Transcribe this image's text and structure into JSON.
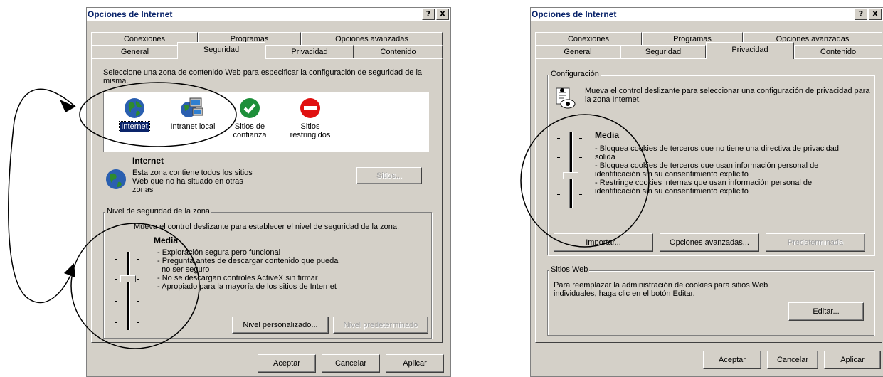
{
  "left_dialog": {
    "title": "Opciones de Internet",
    "title_buttons": [
      "?",
      "X"
    ],
    "tabs_row1": [
      "Conexiones",
      "Programas",
      "Opciones avanzadas"
    ],
    "tabs_row2": [
      "General",
      "Seguridad",
      "Privacidad",
      "Contenido"
    ],
    "active_tab": "Seguridad",
    "instructions": "Seleccione una zona de contenido Web para especificar la configuración de seguridad de la misma.",
    "zones": [
      {
        "label": "Internet",
        "icon": "globe-icon",
        "selected": true
      },
      {
        "label": "Intranet local",
        "icon": "network-computer-icon",
        "selected": false
      },
      {
        "label": "Sitios de confianza",
        "icon": "check-icon",
        "selected": false
      },
      {
        "label": "Sitios restringidos",
        "icon": "no-entry-icon",
        "selected": false
      }
    ],
    "zone_title": "Internet",
    "zone_desc": "Esta zona contiene todos los sitios Web que no ha situado en otras zonas",
    "sites_button": "Sitios...",
    "security_group_title": "Nivel de seguridad de la zona",
    "slider_instruction": "Mueva el control deslizante para establecer el nivel de seguridad de la zona.",
    "level_name": "Media",
    "level_bullets": [
      "- Exploración segura pero funcional",
      "- Pregunta antes de descargar contenido que pueda",
      "  no ser seguro",
      "- No se descargan controles ActiveX sin firmar",
      "- Apropiado para la mayoría de los sitios de Internet"
    ],
    "custom_level_button": "Nivel personalizado...",
    "default_level_button": "Nivel predeterminado",
    "ok_button": "Aceptar",
    "cancel_button": "Cancelar",
    "apply_button": "Aplicar"
  },
  "right_dialog": {
    "title": "Opciones de Internet",
    "title_buttons": [
      "?",
      "X"
    ],
    "tabs_row1": [
      "Conexiones",
      "Programas",
      "Opciones avanzadas"
    ],
    "tabs_row2": [
      "General",
      "Seguridad",
      "Privacidad",
      "Contenido"
    ],
    "active_tab": "Privacidad",
    "config_group_title": "Configuración",
    "config_instruction": "Mueva el control deslizante para seleccionar una configuración de privacidad para la zona Internet.",
    "level_name": "Media",
    "level_bullets": [
      "- Bloquea cookies de terceros que no tiene una directiva de privacidad",
      "sólida",
      "- Bloquea cookies de terceros que usan información personal de",
      "identificación sin su consentimiento explícito",
      "- Restringe cookies internas que usan información personal de",
      "identificación sin su consentimiento explícito"
    ],
    "import_button": "Importar...",
    "advanced_button": "Opciones avanzadas...",
    "default_button": "Predeterminada",
    "websites_group_title": "Sitios Web",
    "websites_text": "Para reemplazar la administración de cookies para sitios Web individuales, haga clic en el botón Editar.",
    "edit_button": "Editar...",
    "ok_button": "Aceptar",
    "cancel_button": "Cancelar",
    "apply_button": "Aplicar"
  },
  "colors": {
    "dialog_bg": "#d4d0c8",
    "title_text": "#0a246a",
    "selection": "#0a246a",
    "annotation": "#000000"
  }
}
